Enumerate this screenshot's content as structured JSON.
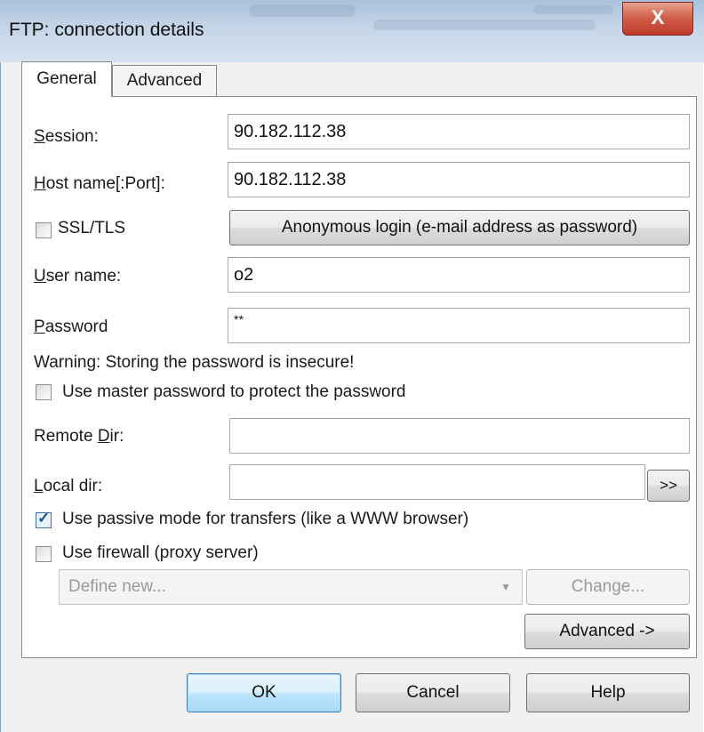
{
  "window": {
    "title": "FTP: connection details",
    "close_glyph": "X"
  },
  "tabs": [
    {
      "label": "General",
      "active": true
    },
    {
      "label": "Advanced",
      "active": false
    }
  ],
  "fields": {
    "session": {
      "label": "Session:",
      "mnemonic": "S",
      "value": "90.182.112.38"
    },
    "host": {
      "label": "Host name[:Port]:",
      "mnemonic": "H",
      "value": "90.182.112.38"
    },
    "ssl": {
      "label": "SSL/TLS",
      "checked": false
    },
    "anonymous_button": "Anonymous login (e-mail address as password)",
    "user": {
      "label": "User name:",
      "mnemonic": "U",
      "value": "o2"
    },
    "password": {
      "label": "Password",
      "mnemonic": "P",
      "value": "**"
    },
    "warning": "Warning: Storing the password is insecure!",
    "master_password": {
      "label": "Use master password to protect the password",
      "checked": false
    },
    "remote_dir": {
      "label": "Remote Dir:",
      "value": ""
    },
    "local_dir": {
      "label": "Local dir:",
      "value": "",
      "browse_label": ">>"
    },
    "passive_mode": {
      "label": "Use passive mode for transfers (like a WWW browser)",
      "checked": true
    },
    "firewall": {
      "label": "Use firewall (proxy server)",
      "checked": false
    },
    "proxy_select": {
      "value": "Define new...",
      "enabled": false
    },
    "change_button": "Change...",
    "advanced_button": "Advanced ->"
  },
  "footer": {
    "ok": "OK",
    "cancel": "Cancel",
    "help": "Help"
  },
  "colors": {
    "titlebar": "#c3d4e7",
    "close": "#c0392b",
    "dialog_bg": "#f0f0f0",
    "panel_bg": "#ffffff"
  }
}
